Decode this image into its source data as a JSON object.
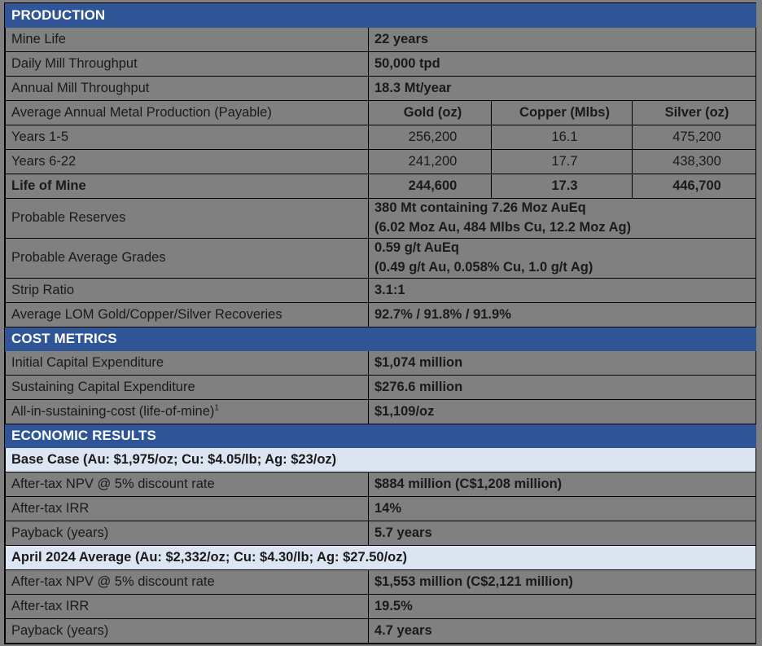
{
  "colors": {
    "section_blue": "#2f5597",
    "sub_blue": "#dce6f2",
    "row_gray": "#808080",
    "border": "#000000"
  },
  "sections": {
    "production": {
      "title": "PRODUCTION",
      "rows": {
        "mine_life": {
          "label": "Mine Life",
          "value": "22 years"
        },
        "daily_mill": {
          "label": "Daily Mill Throughput",
          "value": "50,000 tpd"
        },
        "annual_mill": {
          "label": "Annual Mill Throughput",
          "value": "18.3 Mt/year"
        },
        "avg_annual": {
          "label": "Average Annual Metal Production (Payable)",
          "col_gold": "Gold (oz)",
          "col_copper": "Copper (Mlbs)",
          "col_silver": "Silver (oz)"
        },
        "years_1_5": {
          "label": "Years 1-5",
          "gold": "256,200",
          "copper": "16.1",
          "silver": "475,200"
        },
        "years_6_22": {
          "label": "Years 6-22",
          "gold": "241,200",
          "copper": "17.7",
          "silver": "438,300"
        },
        "life_of_mine": {
          "label": "Life of Mine",
          "gold": "244,600",
          "copper": "17.3",
          "silver": "446,700"
        },
        "probable_reserves": {
          "label": "Probable Reserves",
          "line1": "380 Mt containing 7.26 Moz AuEq",
          "line2": "(6.02 Moz Au, 484 Mlbs Cu, 12.2 Moz Ag)"
        },
        "probable_grades": {
          "label": "Probable Average Grades",
          "line1": "0.59 g/t AuEq",
          "line2": "(0.49 g/t Au, 0.058% Cu, 1.0 g/t Ag)"
        },
        "strip_ratio": {
          "label": "Strip Ratio",
          "value": "3.1:1"
        },
        "recoveries": {
          "label": "Average LOM Gold/Copper/Silver Recoveries",
          "value": "92.7% / 91.8% / 91.9%"
        }
      }
    },
    "cost_metrics": {
      "title": "COST METRICS",
      "rows": {
        "initial_capex": {
          "label": "Initial Capital Expenditure",
          "value": "$1,074 million"
        },
        "sustaining_capex": {
          "label": "Sustaining Capital Expenditure",
          "value": "$276.6 million"
        },
        "aisc": {
          "label": "All-in-sustaining-cost (life-of-mine)",
          "footnote": "1",
          "value": "$1,109/oz"
        }
      }
    },
    "economic_results": {
      "title": "ECONOMIC RESULTS",
      "base_case": {
        "header": "Base Case (Au: $1,975/oz; Cu: $4.05/lb; Ag: $23/oz)",
        "npv": {
          "label": "After-tax NPV @ 5% discount rate",
          "value": "$884 million (C$1,208 million)"
        },
        "irr": {
          "label": "After-tax IRR",
          "value": "14%"
        },
        "payback": {
          "label": "Payback (years)",
          "value": "5.7 years"
        }
      },
      "april_2024": {
        "header": "April 2024 Average (Au: $2,332/oz; Cu: $4.30/lb; Ag: $27.50/oz)",
        "npv": {
          "label": "After-tax NPV @ 5% discount rate",
          "value": "$1,553 million (C$2,121 million)"
        },
        "irr": {
          "label": "After-tax IRR",
          "value": "19.5%"
        },
        "payback": {
          "label": "Payback (years)",
          "value": "4.7 years"
        }
      }
    }
  }
}
